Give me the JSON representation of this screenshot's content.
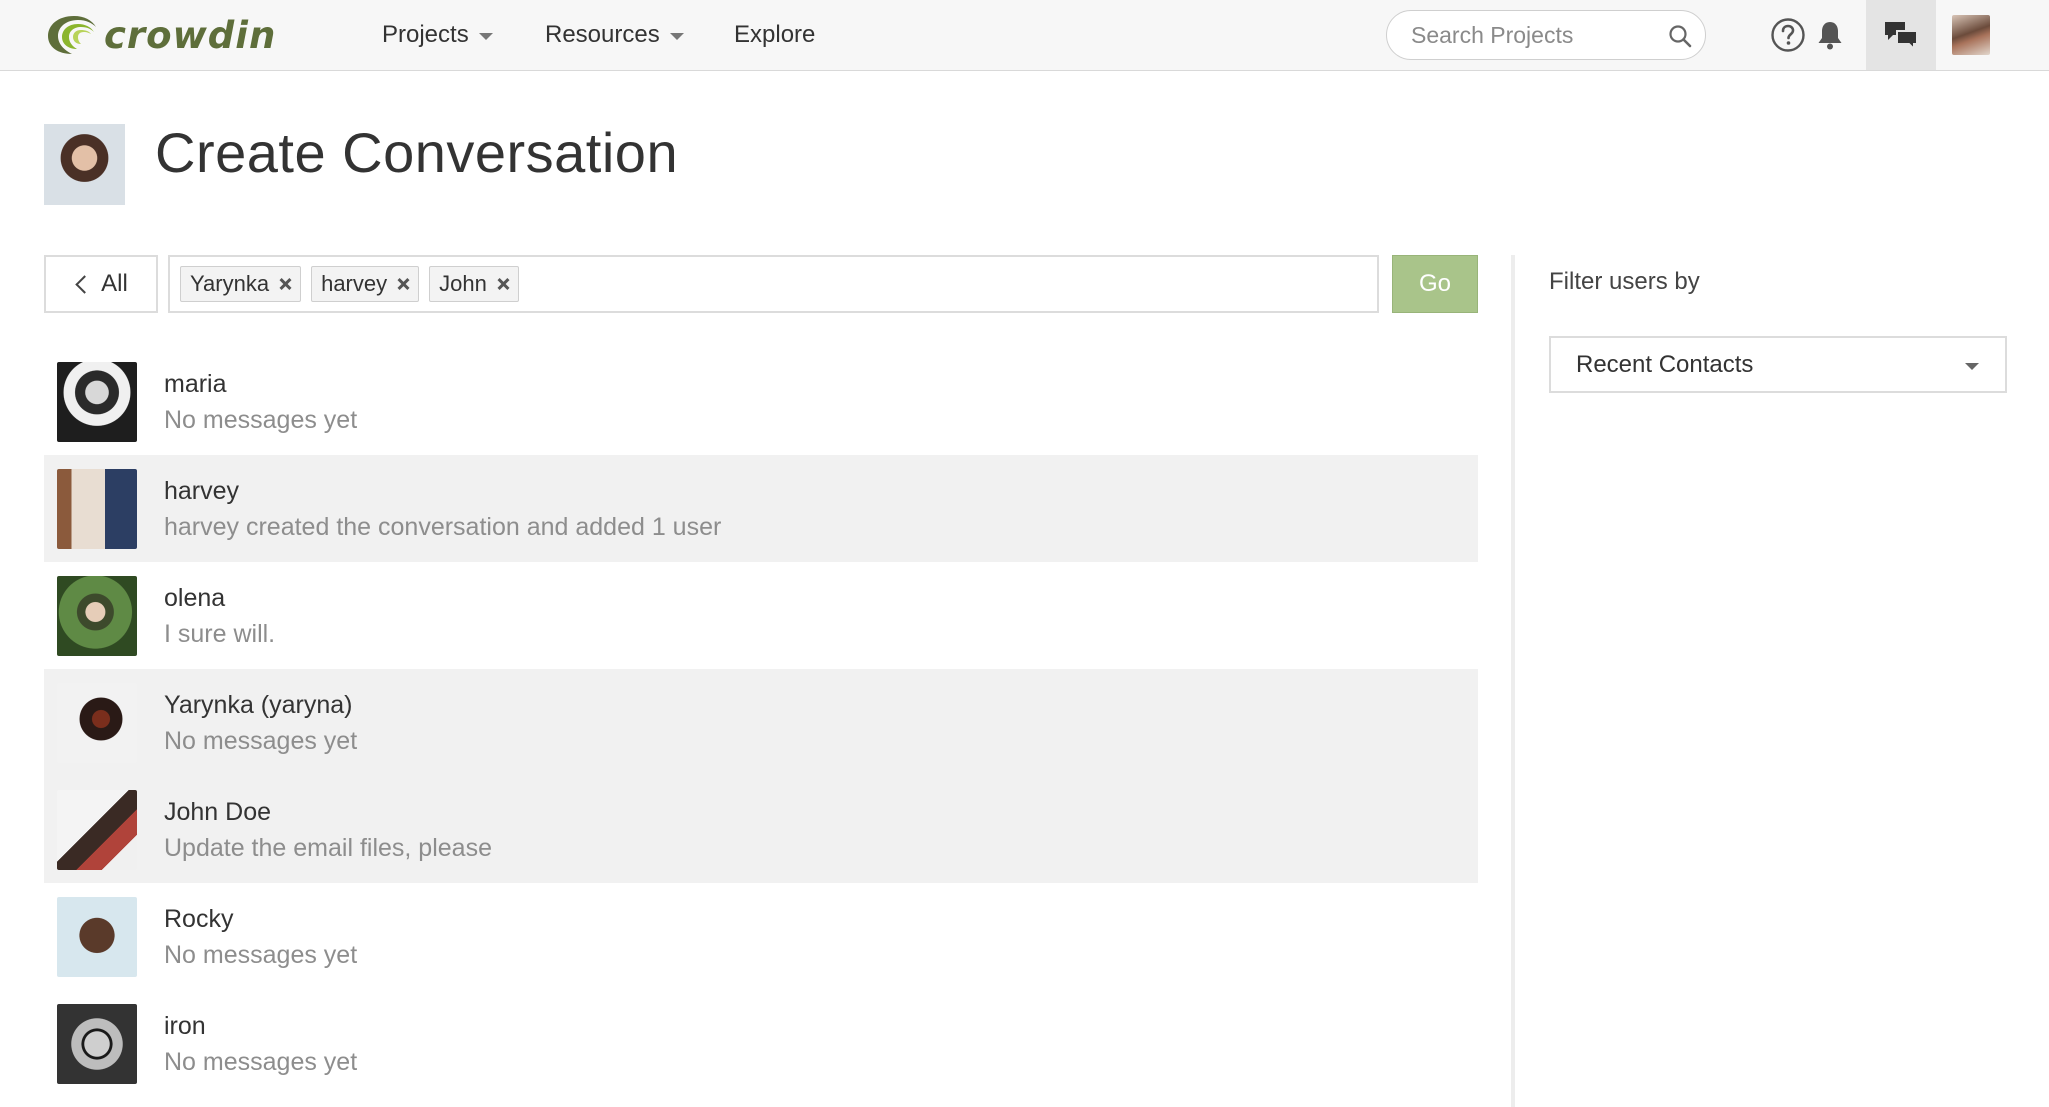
{
  "brand": {
    "name": "crowdin",
    "logo_color": "#5e6e3a",
    "accent": "#8bb52d"
  },
  "nav": {
    "projects": "Projects",
    "resources": "Resources",
    "explore": "Explore"
  },
  "search": {
    "placeholder": "Search Projects",
    "value": ""
  },
  "topbar_icons": [
    "help-icon",
    "bell-icon",
    "chat-bubbles-icon",
    "avatar"
  ],
  "page": {
    "title": "Create Conversation"
  },
  "recipients": {
    "back_label": "All",
    "chips": [
      "Yarynka",
      "harvey",
      "John"
    ],
    "go_label": "Go",
    "go_color": "#a9c48a"
  },
  "conversations": [
    {
      "name": "maria",
      "message": "No messages yet",
      "highlighted": false
    },
    {
      "name": "harvey",
      "message": "harvey created the conversation and added 1 user",
      "highlighted": true
    },
    {
      "name": "olena",
      "message": "I sure will.",
      "highlighted": false
    },
    {
      "name": "Yarynka (yaryna)",
      "message": "No messages yet",
      "highlighted": true
    },
    {
      "name": "John Doe",
      "message": "Update the email files, please",
      "highlighted": true
    },
    {
      "name": "Rocky",
      "message": "No messages yet",
      "highlighted": false
    },
    {
      "name": "iron",
      "message": "No messages yet",
      "highlighted": false
    }
  ],
  "filter": {
    "label": "Filter users by",
    "selected": "Recent Contacts"
  }
}
